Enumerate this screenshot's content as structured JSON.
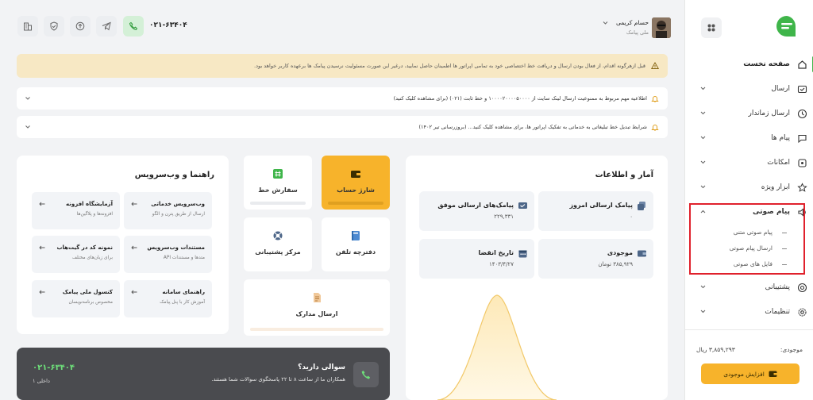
{
  "sidebar": {
    "items": [
      {
        "label": "صفحه نخست",
        "icon": "home-icon",
        "active": true
      },
      {
        "label": "ارسال",
        "icon": "send-message-icon"
      },
      {
        "label": "ارسال زماندار",
        "icon": "clock-send-icon"
      },
      {
        "label": "پیام ها",
        "icon": "message-icon"
      },
      {
        "label": "امکانات",
        "icon": "features-icon"
      },
      {
        "label": "ابزار ویژه",
        "icon": "star-icon"
      },
      {
        "label": "پیام صوتی",
        "icon": "speaker-icon",
        "expanded": true
      },
      {
        "label": "پشتیبانی",
        "icon": "support-icon"
      },
      {
        "label": "تنظیمات",
        "icon": "settings-icon"
      }
    ],
    "voice_sub_items": [
      "پیام صوتی متنی",
      "ارسال پیام صوتی",
      "فایل های صوتی"
    ],
    "balance_label": "موجودی:",
    "balance_value": "۳,۸۵۹,۲۹۳ ریال",
    "increase_button": "افزایش موجودی"
  },
  "header": {
    "user_name": "حسام کریمی",
    "user_role": "ملی پیامک",
    "phone": "۰۲۱-۶۳۴۰۴"
  },
  "notices": {
    "warning": "قبل ازهرگونه اقدام، از فعال بودن ارسال و دریافت خط اختصاصی خود به تمامی اپراتور ها اطمینان حاصل نمایید، درغیر این صورت مسئولیت نرسیدن پیامک ها برعهده کاربر خواهد بود.",
    "items": [
      "اطلاعیه مهم مربوط به ممنوعیت ارسال لینک سایت از ۱۰۰۰۰۲۰۰۰۰۵۰۰۰۰ و خط ثابت (۰۲۱) (برای مشاهده کلیک کنید)",
      "شرایط تبدیل خط تبلیغاتی به خدماتی به تفکیک اپراتور ها، برای مشاهده کلیک کنید... (بروزرسانی تیر ۱۴۰۲)"
    ]
  },
  "stats": {
    "title": "آمار و اطلاعات",
    "boxes": [
      {
        "label": "پیامک ارسالی امروز",
        "value": "۰",
        "icon": "sent-today-icon"
      },
      {
        "label": "پیامک‌های ارسالی موفق",
        "value": "۲۲۹,۳۳۱",
        "icon": "success-sms-icon"
      },
      {
        "label": "موجودی",
        "value": "۳۸۵,۹۲۹ تومان",
        "icon": "wallet-icon"
      },
      {
        "label": "تاریخ انقضا",
        "value": "۱۴۰۳/۴/۲۷",
        "icon": "calendar-icon"
      }
    ]
  },
  "quick_actions": {
    "charge": "شارژ حساب",
    "order_line": "سفارش خط",
    "phonebook": "دفترچه تلفن",
    "support_center": "مرکز پشتیبانی",
    "send_documents": "ارسال مدارک"
  },
  "guide": {
    "title": "راهنما و وب‌سرویس",
    "boxes": [
      {
        "title": "وب‌سرویس خدماتی",
        "sub": "ارسال از طریق پترن و الگو"
      },
      {
        "title": "آزمایشگاه افزونه",
        "sub": "افزونه‌ها و پلاگین‌ها"
      },
      {
        "title": "مستندات وب‌سرویس",
        "sub": "متدها و مستندات API"
      },
      {
        "title": "نمونه کد در گیت‌هاب",
        "sub": "برای زبان‌های مختلف"
      },
      {
        "title": "راهنمای سامانه",
        "sub": "آموزش کار با پنل پیامک"
      },
      {
        "title": "کنسول ملی پیامک",
        "sub": "مخصوص برنامه‌نویسان"
      }
    ]
  },
  "question_banner": {
    "question": "سوالی دارید؟",
    "answer": "همکاران ما از ساعت ۸ تا ۲۲ پاسخگوی سوالات شما هستند.",
    "phone": "۰۲۱-۶۳۴۰۴",
    "extension": "داخلی ۱"
  },
  "colors": {
    "brand_green": "#3fb54a",
    "accent_yellow": "#f7b32b",
    "highlight_red": "#e0212c",
    "warning_bg": "#f7e8c4"
  }
}
